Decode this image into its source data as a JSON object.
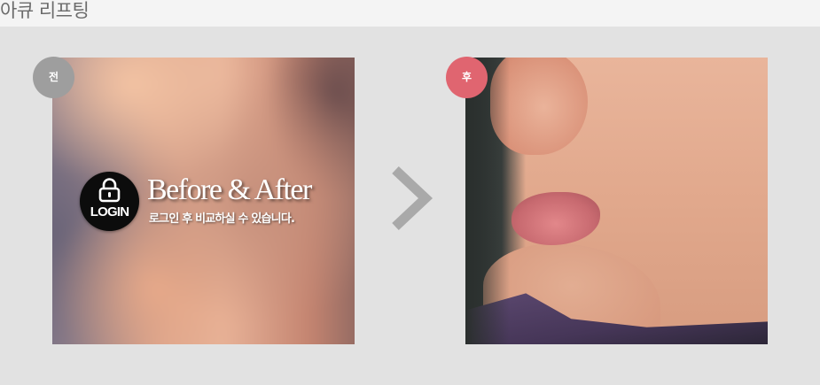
{
  "header": {
    "title": "아큐 리프팅"
  },
  "before": {
    "badge": "전",
    "login_label": "LOGIN",
    "overlay_title": "Before & After",
    "overlay_subtitle": "로그인 후 비교하실 수 있습니다."
  },
  "after": {
    "badge": "후"
  },
  "colors": {
    "background": "#e2e2e2",
    "header_bg": "#f4f4f4",
    "before_badge": "#9e9e9e",
    "after_badge": "#e06570",
    "arrow": "#a9a9a9"
  },
  "icons": {
    "login": "lock-icon",
    "next": "chevron-right-icon"
  }
}
